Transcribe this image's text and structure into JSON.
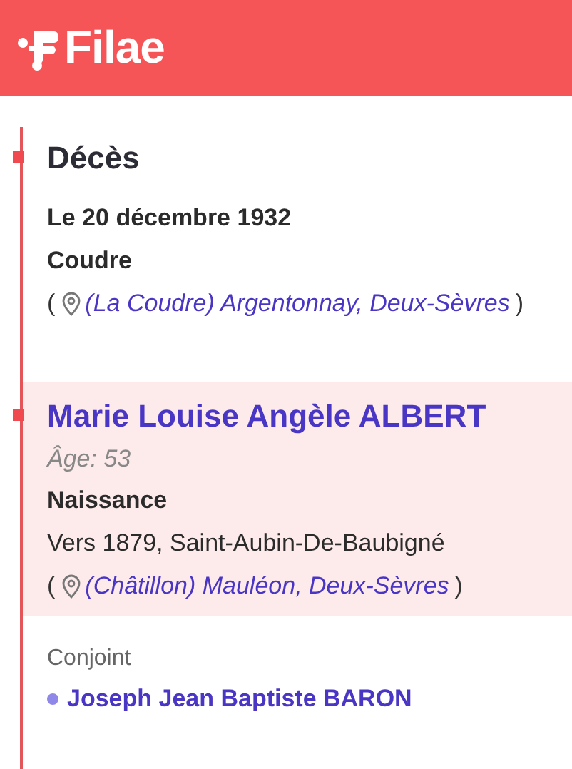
{
  "header": {
    "logo_text": "Filae"
  },
  "death": {
    "title": "Décès",
    "date": "Le 20 décembre 1932",
    "place_name": "Coudre",
    "place": {
      "open": "(",
      "link": "(La Coudre) Argentonnay, Deux-Sèvres",
      "close": ")"
    }
  },
  "person": {
    "name": "Marie Louise Angèle ALBERT",
    "age": "Âge: 53",
    "event": "Naissance",
    "details": "Vers 1879, Saint-Aubin-De-Baubigné",
    "place": {
      "open": "(",
      "link": "(Châtillon) Mauléon, Deux-Sèvres",
      "close": ")"
    }
  },
  "spouse": {
    "label": "Conjoint",
    "name": "Joseph Jean Baptiste BARON"
  }
}
